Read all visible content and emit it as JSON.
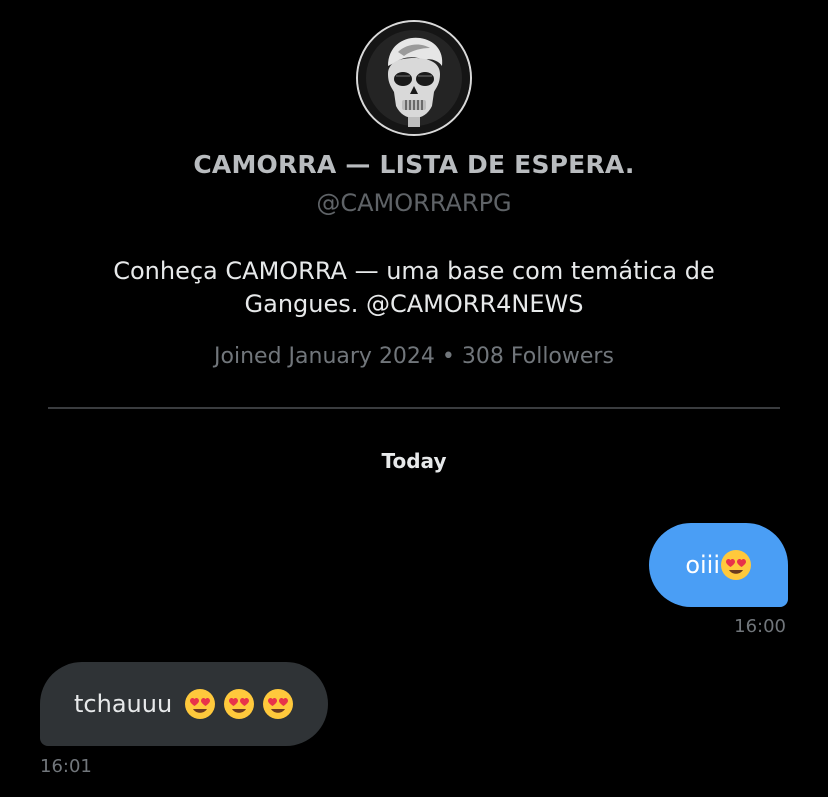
{
  "profile": {
    "avatar_icon": "skull-avatar-icon",
    "name": "CAMORRA — LISTA DE ESPERA.",
    "handle": "@CAMORRARPG",
    "bio_line1": "Conheça CAMORRA — uma base com temática de",
    "bio_line2": "Gangues. @CAMORR4NEWS",
    "meta": "Joined January 2024 • 308 Followers"
  },
  "conversation": {
    "day_label": "Today",
    "messages": [
      {
        "direction": "outgoing",
        "text": "oiii",
        "emoji": "heart-eyes-icon",
        "emoji_count": 1,
        "time": "16:00"
      },
      {
        "direction": "incoming",
        "text": "tchauuu",
        "emoji": "heart-eyes-icon",
        "emoji_count": 3,
        "time": "16:01"
      }
    ]
  },
  "colors": {
    "background": "#000000",
    "outgoing_bubble": "#4a9ef5",
    "incoming_bubble": "#2f3336",
    "secondary_text": "#71767b"
  }
}
